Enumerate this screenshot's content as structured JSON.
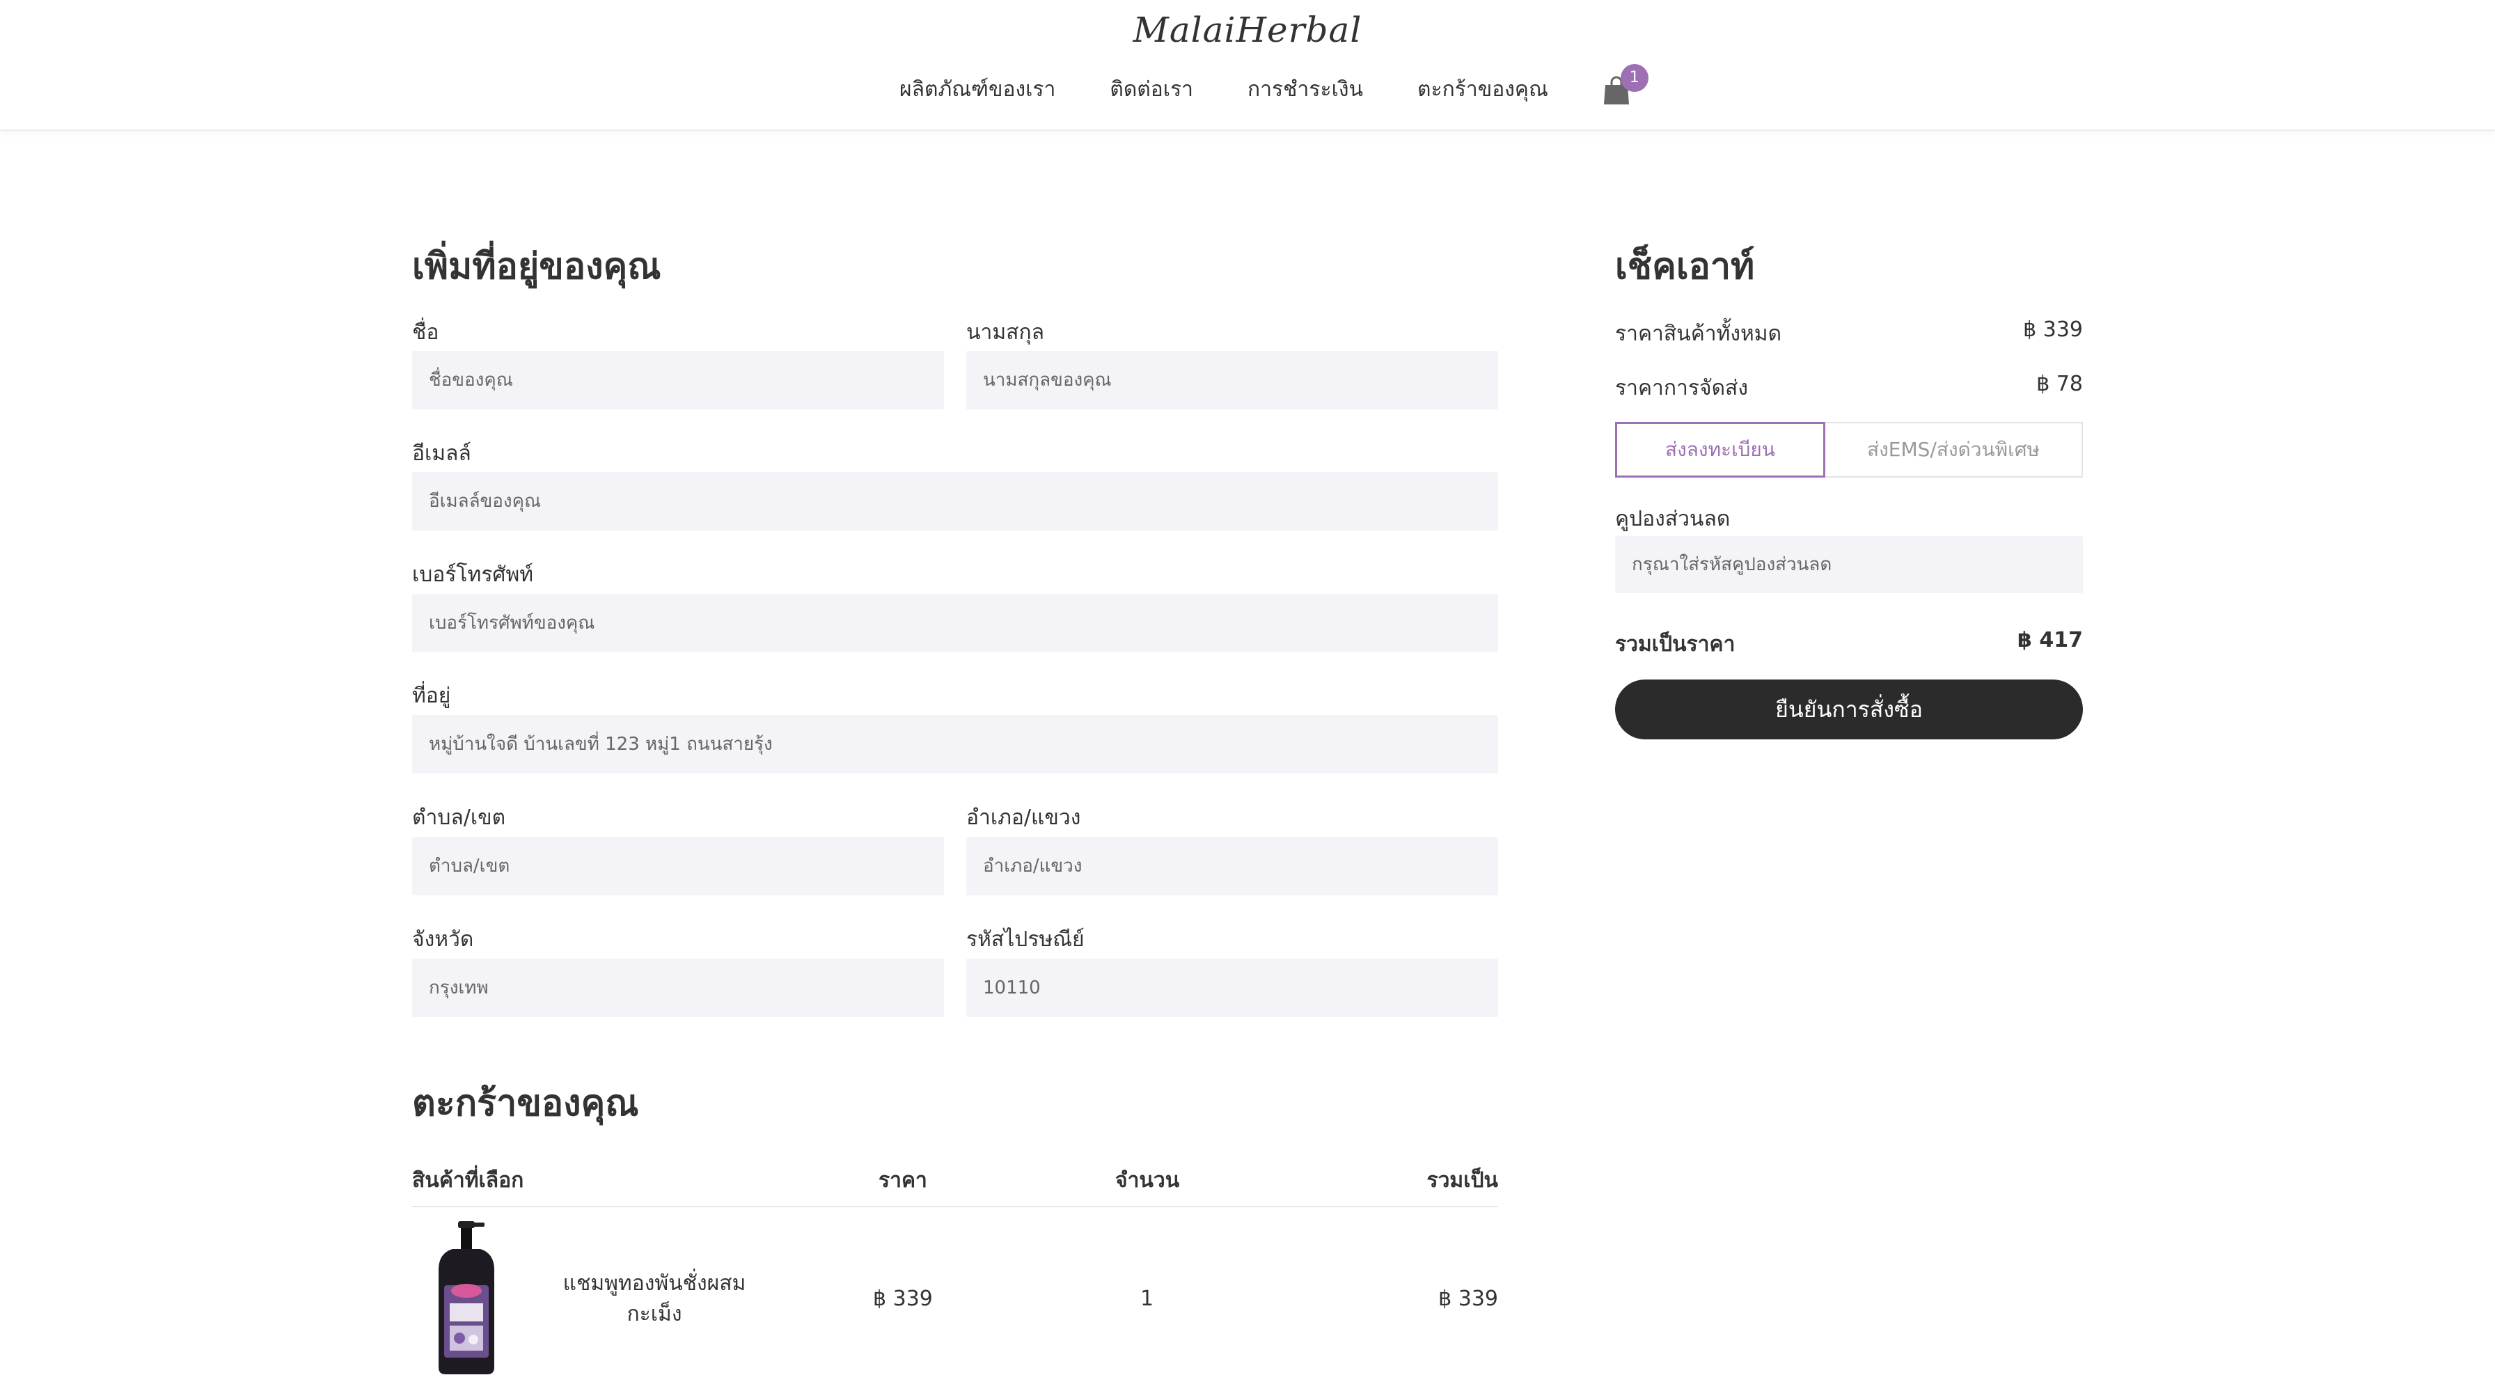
{
  "header": {
    "logo": "MalaiHerbal",
    "nav": [
      "ผลิตภัณฑ์ของเรา",
      "ติดต่อเรา",
      "การชำระเงิน",
      "ตะกร้าของคุณ"
    ],
    "cart_count": "1",
    "cart_icon": "shopping-bag-icon"
  },
  "address_form": {
    "title": "เพิ่มที่อยู่ของคุณ",
    "first_name": {
      "label": "ชื่อ",
      "placeholder": "ชื่อของคุณ"
    },
    "last_name": {
      "label": "นามสกุล",
      "placeholder": "นามสกุลของคุณ"
    },
    "email": {
      "label": "อีเมลล์",
      "placeholder": "อีเมลล์ของคุณ"
    },
    "phone": {
      "label": "เบอร์โทรศัพท์",
      "placeholder": "เบอร์โทรศัพท์ของคุณ"
    },
    "address": {
      "label": "ที่อยู่",
      "placeholder": "หมู่บ้านใจดี บ้านเลขที่ 123 หมู่1 ถนนสายรุ้ง"
    },
    "subdistrict": {
      "label": "ตำบล/เขต",
      "placeholder": "ตำบล/เขต"
    },
    "district": {
      "label": "อำเภอ/แขวง",
      "placeholder": "อำเภอ/แขวง"
    },
    "province": {
      "label": "จังหวัด",
      "placeholder": "กรุงเทพ"
    },
    "postal_code": {
      "label": "รหัสไปรษณีย์",
      "placeholder": "10110"
    }
  },
  "cart": {
    "title": "ตะกร้าของคุณ",
    "columns": [
      "สินค้าที่เลือก",
      "ราคา",
      "จำนวน",
      "รวมเป็น"
    ],
    "items": [
      {
        "name": "แชมพูทองพันชั่งผสมกะเม็ง",
        "price": "฿ 339",
        "quantity": "1",
        "total": "฿ 339"
      }
    ]
  },
  "checkout": {
    "title": "เช็คเอาท์",
    "subtotal_label": "ราคาสินค้าทั้งหมด",
    "subtotal_value": "฿ 339",
    "shipping_label": "ราคาการจัดส่ง",
    "shipping_value": "฿ 78",
    "shipping_options": [
      "ส่งลงทะเบียน",
      "ส่งEMS/ส่งด่วนพิเศษ"
    ],
    "coupon_label": "คูปองส่วนลด",
    "coupon_placeholder": "กรุณาใส่รหัสคูปองส่วนลด",
    "total_label": "รวมเป็นราคา",
    "total_value": "฿ 417",
    "confirm_label": "ยืนยันการสั่งซื้อ",
    "accent_color": "#9d6fb4"
  }
}
